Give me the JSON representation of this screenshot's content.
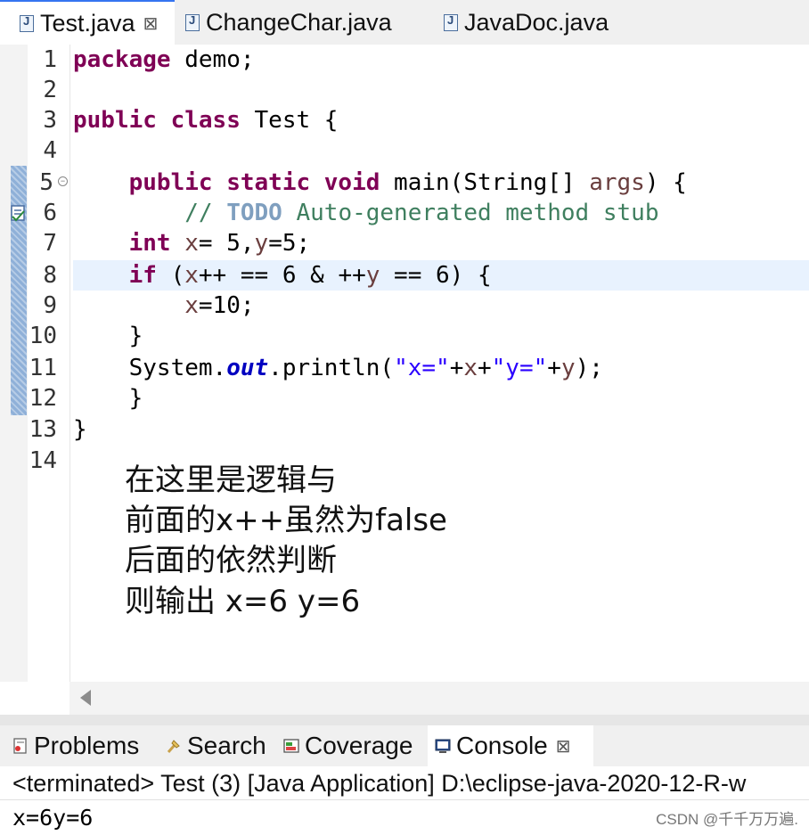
{
  "editor_tabs": [
    {
      "label": "Test.java",
      "close": "⊠"
    },
    {
      "label": "ChangeChar.java"
    },
    {
      "label": "JavaDoc.java"
    }
  ],
  "code": {
    "line_numbers": [
      "1",
      "2",
      "3",
      "4",
      "5",
      "6",
      "7",
      "8",
      "9",
      "10",
      "11",
      "12",
      "13",
      "14"
    ],
    "l1": {
      "kw": "package",
      "rest": " demo;"
    },
    "l3": {
      "kw1": "public",
      "kw2": "class",
      "rest": " Test {"
    },
    "l5": {
      "indent": "    ",
      "kw1": "public",
      "kw2": "static",
      "kw3": "void",
      "rest1": " main(String[] ",
      "param": "args",
      "rest2": ") {"
    },
    "l6": {
      "indent": "        ",
      "c1": "// ",
      "todo": "TODO",
      "c2": " Auto-generated method stub"
    },
    "l7": {
      "indent": "    ",
      "kw": "int",
      "sp": " ",
      "v1": "x",
      "mid": "= 5,",
      "v2": "y",
      "end": "=5;"
    },
    "l8": {
      "indent": "    ",
      "kw": "if",
      "p1": " (",
      "v1": "x",
      "p2": "++ == 6 & ++",
      "v2": "y",
      "p3": " == 6) {"
    },
    "l9": {
      "indent": "        ",
      "v": "x",
      "rest": "=10;"
    },
    "l10": {
      "text": "    }"
    },
    "l11": {
      "indent": "    ",
      "p1": "System.",
      "fld": "out",
      "p2": ".println(",
      "s1": "\"x=\"",
      "p3": "+",
      "v1": "x",
      "p4": "+",
      "s2": "\"y=\"",
      "p5": "+",
      "v2": "y",
      "p6": ");"
    },
    "l12": {
      "text": "    }"
    },
    "l13": {
      "text": "}"
    }
  },
  "note_lines": [
    "在这里是逻辑与",
    "前面的x++虽然为false",
    "后面的依然判断",
    "则输出 x=6 y=6"
  ],
  "view_tabs": [
    {
      "label": "Problems"
    },
    {
      "label": "Search"
    },
    {
      "label": "Coverage"
    },
    {
      "label": "Console",
      "close": "⊠"
    }
  ],
  "console": {
    "header": "<terminated> Test (3) [Java Application] D:\\eclipse-java-2020-12-R-w",
    "output": "x=6y=6"
  },
  "watermark": "CSDN @千千万万遍.",
  "colors": {
    "keyword": "#7f0055",
    "comment": "#3f7f5f",
    "string": "#2a00ff",
    "field": "#0000c0",
    "local_var": "#6a3e3e"
  }
}
